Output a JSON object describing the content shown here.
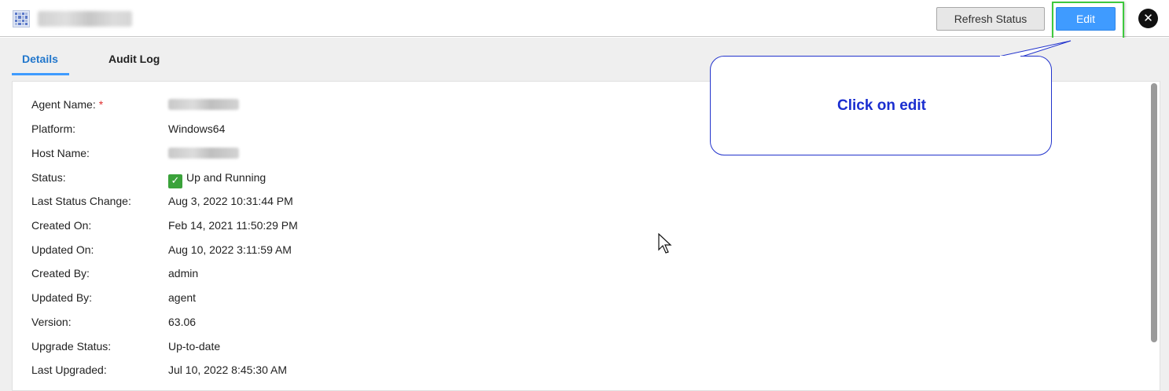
{
  "header": {
    "title": "prodagent-dev",
    "refresh_label": "Refresh Status",
    "edit_label": "Edit",
    "close_icon": "close-icon",
    "accent_color": "#3f9bff"
  },
  "tabs": [
    {
      "label": "Details",
      "active": true
    },
    {
      "label": "Audit Log",
      "active": false
    }
  ],
  "details": {
    "agent_name": {
      "label": "Agent Name:",
      "required_mark": "*",
      "value": "prodagent-dev"
    },
    "platform": {
      "label": "Platform:",
      "value": "Windows64"
    },
    "host_name": {
      "label": "Host Name:",
      "value": "prodagent-dev"
    },
    "status": {
      "label": "Status:",
      "value": "Up and Running",
      "icon": "check-icon",
      "color": "#3aa23a"
    },
    "last_status_change": {
      "label": "Last Status Change:",
      "value": "Aug 3, 2022 10:31:44 PM"
    },
    "created_on": {
      "label": "Created On:",
      "value": "Feb 14, 2021 11:50:29 PM"
    },
    "updated_on": {
      "label": "Updated On:",
      "value": "Aug 10, 2022 3:11:59 AM"
    },
    "created_by": {
      "label": "Created By:",
      "value": "admin"
    },
    "updated_by": {
      "label": "Updated By:",
      "value": "agent"
    },
    "version": {
      "label": "Version:",
      "value": "63.06"
    },
    "upgrade_status": {
      "label": "Upgrade Status:",
      "value": "Up-to-date"
    },
    "last_upgraded": {
      "label": "Last Upgraded:",
      "value": "Jul 10, 2022 8:45:30 AM"
    }
  },
  "callout": {
    "text": "Click on edit",
    "color": "#1a2ed0",
    "highlight_color": "#3ec93e"
  }
}
